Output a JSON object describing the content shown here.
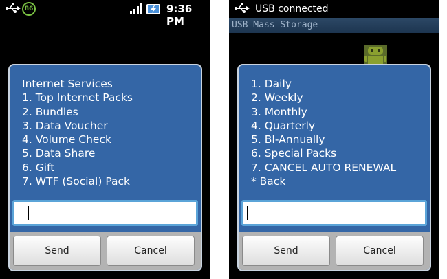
{
  "left_phone": {
    "status": {
      "badge": "86",
      "time": "9:36 PM",
      "icons": [
        "usb-icon",
        "notification-badge-icon",
        "signal-icon",
        "battery-charging-icon"
      ]
    },
    "menu": [
      "Internet Services",
      "1. Top Internet Packs",
      "2. Bundles",
      "3. Data Voucher",
      "4. Volume Check",
      "5. Data Share",
      "6. Gift",
      "7. WTF (Social) Pack"
    ],
    "input_value": "",
    "send_label": "Send",
    "cancel_label": "Cancel"
  },
  "right_phone": {
    "status": {
      "usb_text": "USB connected",
      "icons": [
        "usb-icon"
      ]
    },
    "notification": "USB Mass Storage",
    "menu": [
      "1. Daily",
      "2. Weekly",
      "3. Monthly",
      "4. Quarterly",
      "5. BI-Annually",
      "6. Special Packs",
      "7. CANCEL AUTO RENEWAL",
      "* Back"
    ],
    "input_value": "",
    "send_label": "Send",
    "cancel_label": "Cancel"
  },
  "colors": {
    "dialog_bg": "#3466a6",
    "input_border": "#5ba4d8",
    "badge_green": "#7ac143",
    "android_green": "#a4c639"
  }
}
